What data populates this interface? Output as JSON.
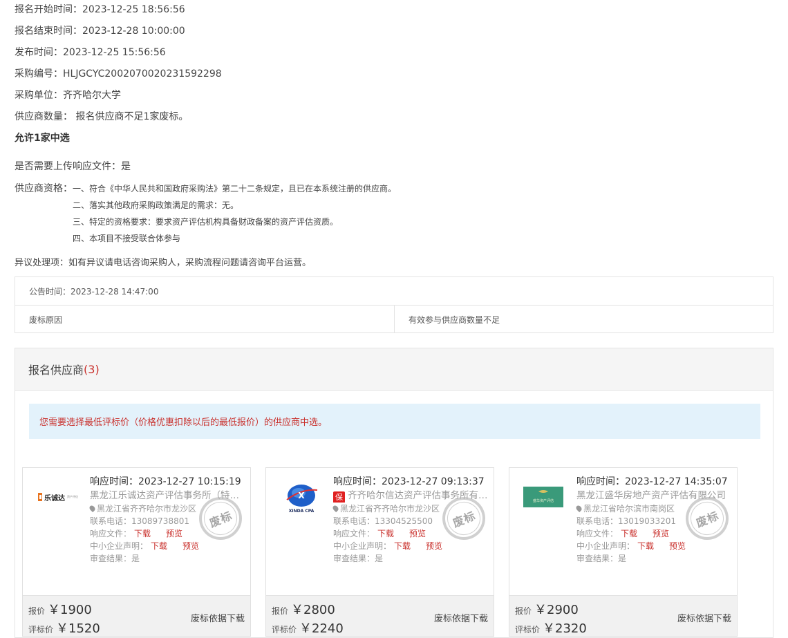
{
  "info": {
    "start_time": "报名开始时间：2023-12-25 18:56:56",
    "end_time": "报名结束时间：2023-12-28 10:00:00",
    "publish_time": "发布时间：2023-12-25 15:56:56",
    "purchase_no": "采购编号：HLJGCYC2002070020231592298",
    "purchaser": "采购单位：齐齐哈尔大学",
    "supplier_count": "供应商数量： 报名供应商不足1家废标。",
    "allow_winners": "允许1家中选",
    "upload_required": "是否需要上传响应文件：是"
  },
  "qualification": {
    "label": "供应商资格：",
    "items": [
      "一、符合《中华人民共和国政府采购法》第二十二条规定，且已在本系统注册的供应商。",
      "二、落实其他政府采购政策满足的需求：无。",
      "三、特定的资格要求：要求资产评估机构具备财政备案的资产评估资质。",
      "四、本项目不接受联合体参与"
    ]
  },
  "objection": "异议处理项：如有异议请电话咨询采购人，采购流程问题请咨询平台运营。",
  "notice": {
    "time": "公告时间：2023-12-28 14:47:00",
    "reason_label": "废标原因",
    "reason_value": "有效参与供应商数量不足"
  },
  "panel": {
    "title": "报名供应商",
    "count": "(3)",
    "alert": "您需要选择最低评标价（价格优惠扣除以后的最低报价）的供应商中选。"
  },
  "labels": {
    "resp_file": "响应文件：",
    "sme": "中小企业声明：",
    "review": "审查结果：",
    "download": "下载",
    "preview": "预览",
    "quote": "报价",
    "eval_price": "评标价",
    "basis_download": "废标依据下载",
    "stamp": "废标"
  },
  "suppliers": [
    {
      "resp_time": "响应时间：2023-12-27 10:15:19",
      "name": "黑龙江乐诚达资产评估事务所（特殊普通合伙）",
      "address": "黑龙江省齐齐哈尔市龙沙区",
      "phone": "联系电话：13089738801",
      "review": "是",
      "quote": "￥1900",
      "eval": "￥1520",
      "logo_text": "乐诚达",
      "logo_sub": "资产评估"
    },
    {
      "resp_time": "响应时间：2023-12-27 09:13:37",
      "name": "齐齐哈尔信达资产评估事务所有限公司",
      "badge": "保",
      "address": "黑龙江省齐齐哈尔市龙沙区",
      "phone": "联系电话：13304525500",
      "review": "是",
      "quote": "￥2800",
      "eval": "￥2240",
      "logo_text": "XINDA CPA"
    },
    {
      "resp_time": "响应时间：2023-12-27 14:35:07",
      "name": "黑龙江盛华房地产资产评估有限公司",
      "address": "黑龙江省哈尔滨市南岗区",
      "phone": "联系电话：13019033201",
      "review": "是",
      "quote": "￥2900",
      "eval": "￥2320",
      "logo_text": "盛华资产评估"
    }
  ],
  "colors": {
    "accent_red": "#c9302c",
    "alert_bg": "#e3f2fb"
  }
}
